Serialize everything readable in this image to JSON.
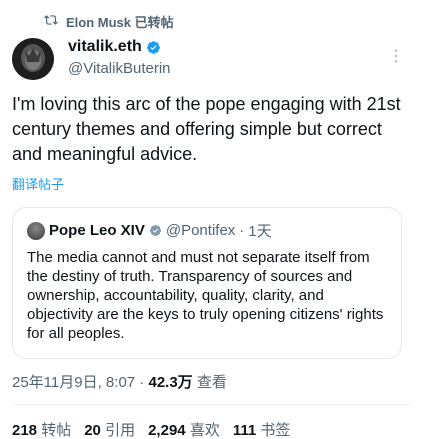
{
  "repost": {
    "label": "Elon Musk 已转帖"
  },
  "author": {
    "name": "vitalik.eth",
    "handle": "@VitalikButerin"
  },
  "post": {
    "text": "I'm loving this arc of the pope engaging with 21st century themes and offering simple but correct and meaningful advice.",
    "translate_label": "翻译帖子"
  },
  "quote": {
    "name": "Pope Leo XIV",
    "handle": "@Pontifex",
    "separator": "·",
    "time": "1天",
    "text": "The media cannot and must not separate itself from the destiny of truth. Transparency of sources and ownership, accountability, quality, clarity, and objectivity are the keys to truly opening citizens' rights for all peoples."
  },
  "meta": {
    "date": "25年11月9日, 8:07",
    "separator": "·",
    "views": "42.3万",
    "views_label": "查看"
  },
  "stats": {
    "reposts": "218",
    "reposts_label": "转帖",
    "quotes": "20",
    "quotes_label": "引用",
    "likes": "2,294",
    "likes_label": "喜欢",
    "bookmarks": "111",
    "bookmarks_label": "书签"
  },
  "colors": {
    "accent": "#1d9bf0",
    "secondary": "#536471",
    "text": "#0f1419"
  }
}
